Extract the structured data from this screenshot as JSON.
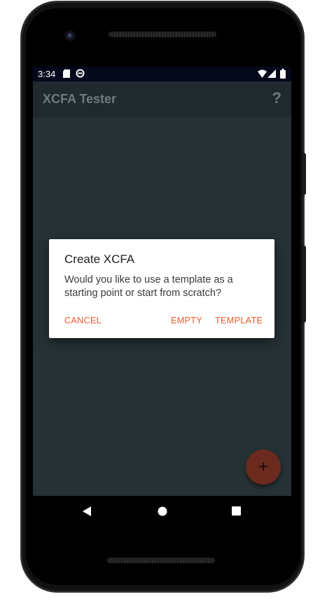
{
  "status_bar": {
    "time": "3:34"
  },
  "app_bar": {
    "title": "XCFA Tester",
    "help_label": "?"
  },
  "dialog": {
    "title": "Create XCFA",
    "message": "Would you like to use a template as a starting point or start from scratch?",
    "buttons": {
      "cancel": "CANCEL",
      "empty": "EMPTY",
      "template": "TEMPLATE"
    }
  },
  "fab": {
    "label": "+"
  },
  "colors": {
    "accent": "#f0582c",
    "background": "#263238",
    "app_bar": "#1f292e",
    "status_bar": "#04081a",
    "fab": "#6b2a1d"
  },
  "icons": {
    "status": [
      "sd-card-icon",
      "no-disturb-icon",
      "wifi-icon",
      "signal-icon",
      "battery-icon"
    ],
    "nav": [
      "back-icon",
      "home-icon",
      "recents-icon"
    ]
  }
}
